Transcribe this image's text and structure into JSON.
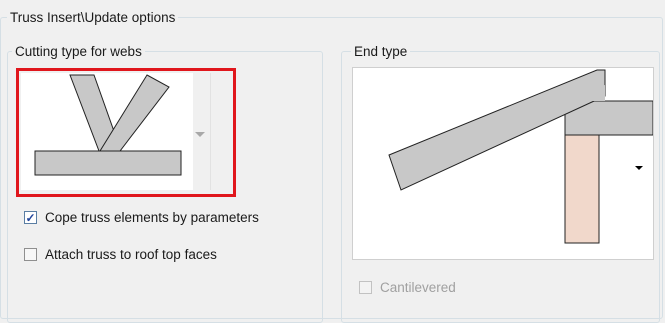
{
  "outer_group": {
    "title": "Truss Insert\\Update options"
  },
  "cutting_group": {
    "title": "Cutting type for webs",
    "dropdown": {
      "selected": "web-cut-preview",
      "arrow": "chevron-down-icon"
    }
  },
  "end_group": {
    "title": "End type",
    "dropdown": {
      "selected": "end-type-preview",
      "arrow": "triangle-down-icon"
    },
    "cantilevered": {
      "label": "Cantilevered",
      "checked": false,
      "enabled": false
    }
  },
  "options": {
    "cope": {
      "label": "Cope truss elements by parameters",
      "checked": true
    },
    "attach": {
      "label": "Attach truss to roof top faces",
      "checked": false
    }
  },
  "colors": {
    "member_fill": "#c8c8c8",
    "member_stroke": "#222222",
    "post_fill": "#f1d8cb",
    "highlight": "#e0161c",
    "checkmark": "#21459c"
  }
}
